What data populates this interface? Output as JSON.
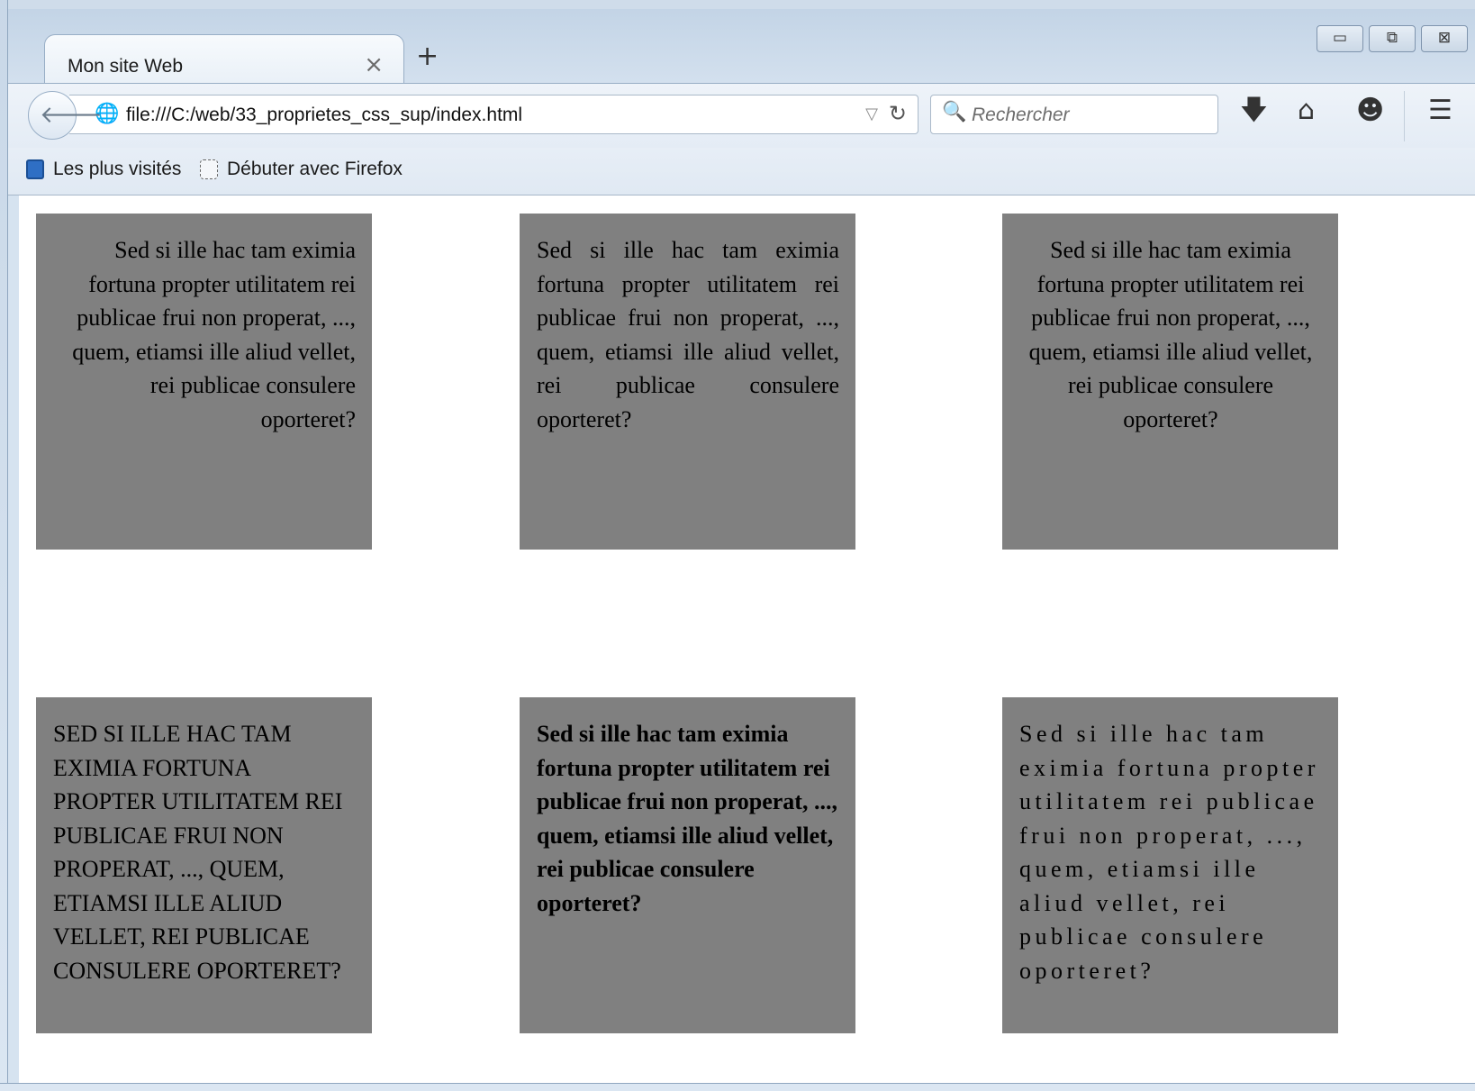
{
  "browser": {
    "tab_title": "Mon site Web",
    "tab_close": "×",
    "new_tab": "+",
    "url": "file:///C:/web/33_proprietes_css_sup/index.html",
    "search_placeholder": "Rechercher",
    "window_controls": [
      "minimize",
      "maximize",
      "close"
    ]
  },
  "icons": {
    "back": "back-arrow-icon",
    "site": "globe-icon",
    "url_dropdown": "dropdown-triangle-icon",
    "reload": "reload-icon",
    "search": "magnifier-icon",
    "downloads": "download-arrow-icon",
    "home": "home-icon",
    "hello": "chat-bubble-icon",
    "menu": "hamburger-menu-icon"
  },
  "bookmarks": [
    {
      "label": "Les plus visités"
    },
    {
      "label": "Débuter avec Firefox"
    }
  ],
  "page": {
    "boxes": [
      {
        "text": "Sed si ille hac tam eximia fortuna propter utilitatem rei publicae frui non properat, ..., quem, etiamsi ille aliud vellet, rei publicae consulere oporteret?"
      },
      {
        "text": "Sed si ille hac tam eximia fortuna propter utilitatem rei publicae frui non properat, ..., quem, etiamsi ille aliud vellet, rei publicae consulere oporteret?"
      },
      {
        "text": "Sed si ille hac tam eximia fortuna propter utilitatem rei publicae frui non properat, ..., quem, etiamsi ille aliud vellet, rei publicae consulere oporteret?"
      },
      {
        "text": "Sed si ille hac tam eximia fortuna propter utilitatem rei publicae frui non properat, ..., quem, etiamsi ille aliud vellet, rei publicae consulere oporteret?"
      },
      {
        "text": "Sed si ille hac tam eximia fortuna propter utilitatem rei publicae frui non properat, ..., quem, etiamsi ille aliud vellet, rei publicae consulere oporteret?"
      },
      {
        "text": "Sed si ille hac tam eximia fortuna propter utilitatem rei publicae frui non properat, ..., quem, etiamsi ille aliud vellet, rei publicae consulere oporteret?"
      }
    ],
    "box_color": "#808080"
  }
}
